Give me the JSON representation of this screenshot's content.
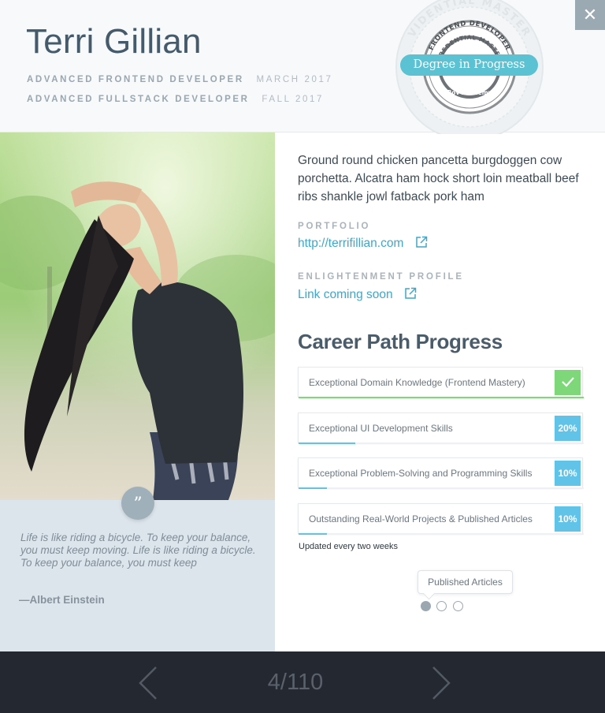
{
  "profile": {
    "name": "Terri Gillian",
    "degrees": [
      {
        "title": "ADVANCED FRONTEND DEVELOPER",
        "date": "MARCH 2017"
      },
      {
        "title": "ADVANCED FULLSTACK DEVELOPER",
        "date": "FALL 2017"
      }
    ],
    "bio": "Ground round chicken pancetta burgdoggen cow porchetta. Alcatra ham hock short loin meatball beef ribs shankle jowl fatback pork ham"
  },
  "badge": {
    "seal_top_text": "FRONTEND DEVELOPER",
    "seal_inner_text": "CREDENTIAL MASTER",
    "seal_bottom_text": "Bov Academy",
    "seal_faded_text": "VIDENTIAL MASTER",
    "pill_label": "Degree in Progress",
    "pill_color": "#5bc2d3"
  },
  "close_button": {
    "icon": "close-icon",
    "glyph": "✕"
  },
  "quote": {
    "icon_glyph": "”",
    "text": "Life is like riding a bicycle. To keep your balance, you must keep moving. Life is like riding a bicycle. To keep your balance, you must keep",
    "author": "—Albert Einstein"
  },
  "links": {
    "portfolio_heading": "PORTFOLIO",
    "portfolio_url": "http://terrifillian.com",
    "enlightenment_heading": "ENLIGHTENMENT PROFILE",
    "enlightenment_text": "Link coming soon",
    "external_icon": "external-link-icon"
  },
  "career": {
    "title": "Career Path Progress",
    "skills": [
      {
        "label": "Exceptional Domain Knowledge (Frontend Mastery)",
        "progress": 1.0,
        "display": "",
        "completed": true,
        "color": "#7ed87a"
      },
      {
        "label": "Exceptional UI Development Skills",
        "progress": 0.2,
        "display": "20%",
        "completed": false,
        "color": "#62c3e9"
      },
      {
        "label": "Exceptional Problem-Solving and Programming Skills",
        "progress": 0.1,
        "display": "10%",
        "completed": false,
        "color": "#62c3e9"
      },
      {
        "label": "Outstanding Real-World Projects & Published  Articles",
        "progress": 0.1,
        "display": "10%",
        "completed": false,
        "color": "#62c3e9"
      }
    ],
    "update_note": "Updated every two weeks"
  },
  "carousel": {
    "tooltip": "Published Articles",
    "active_index": 0,
    "dot_count": 3
  },
  "pagination": {
    "current": "4",
    "total": "110",
    "display": "4/110"
  }
}
